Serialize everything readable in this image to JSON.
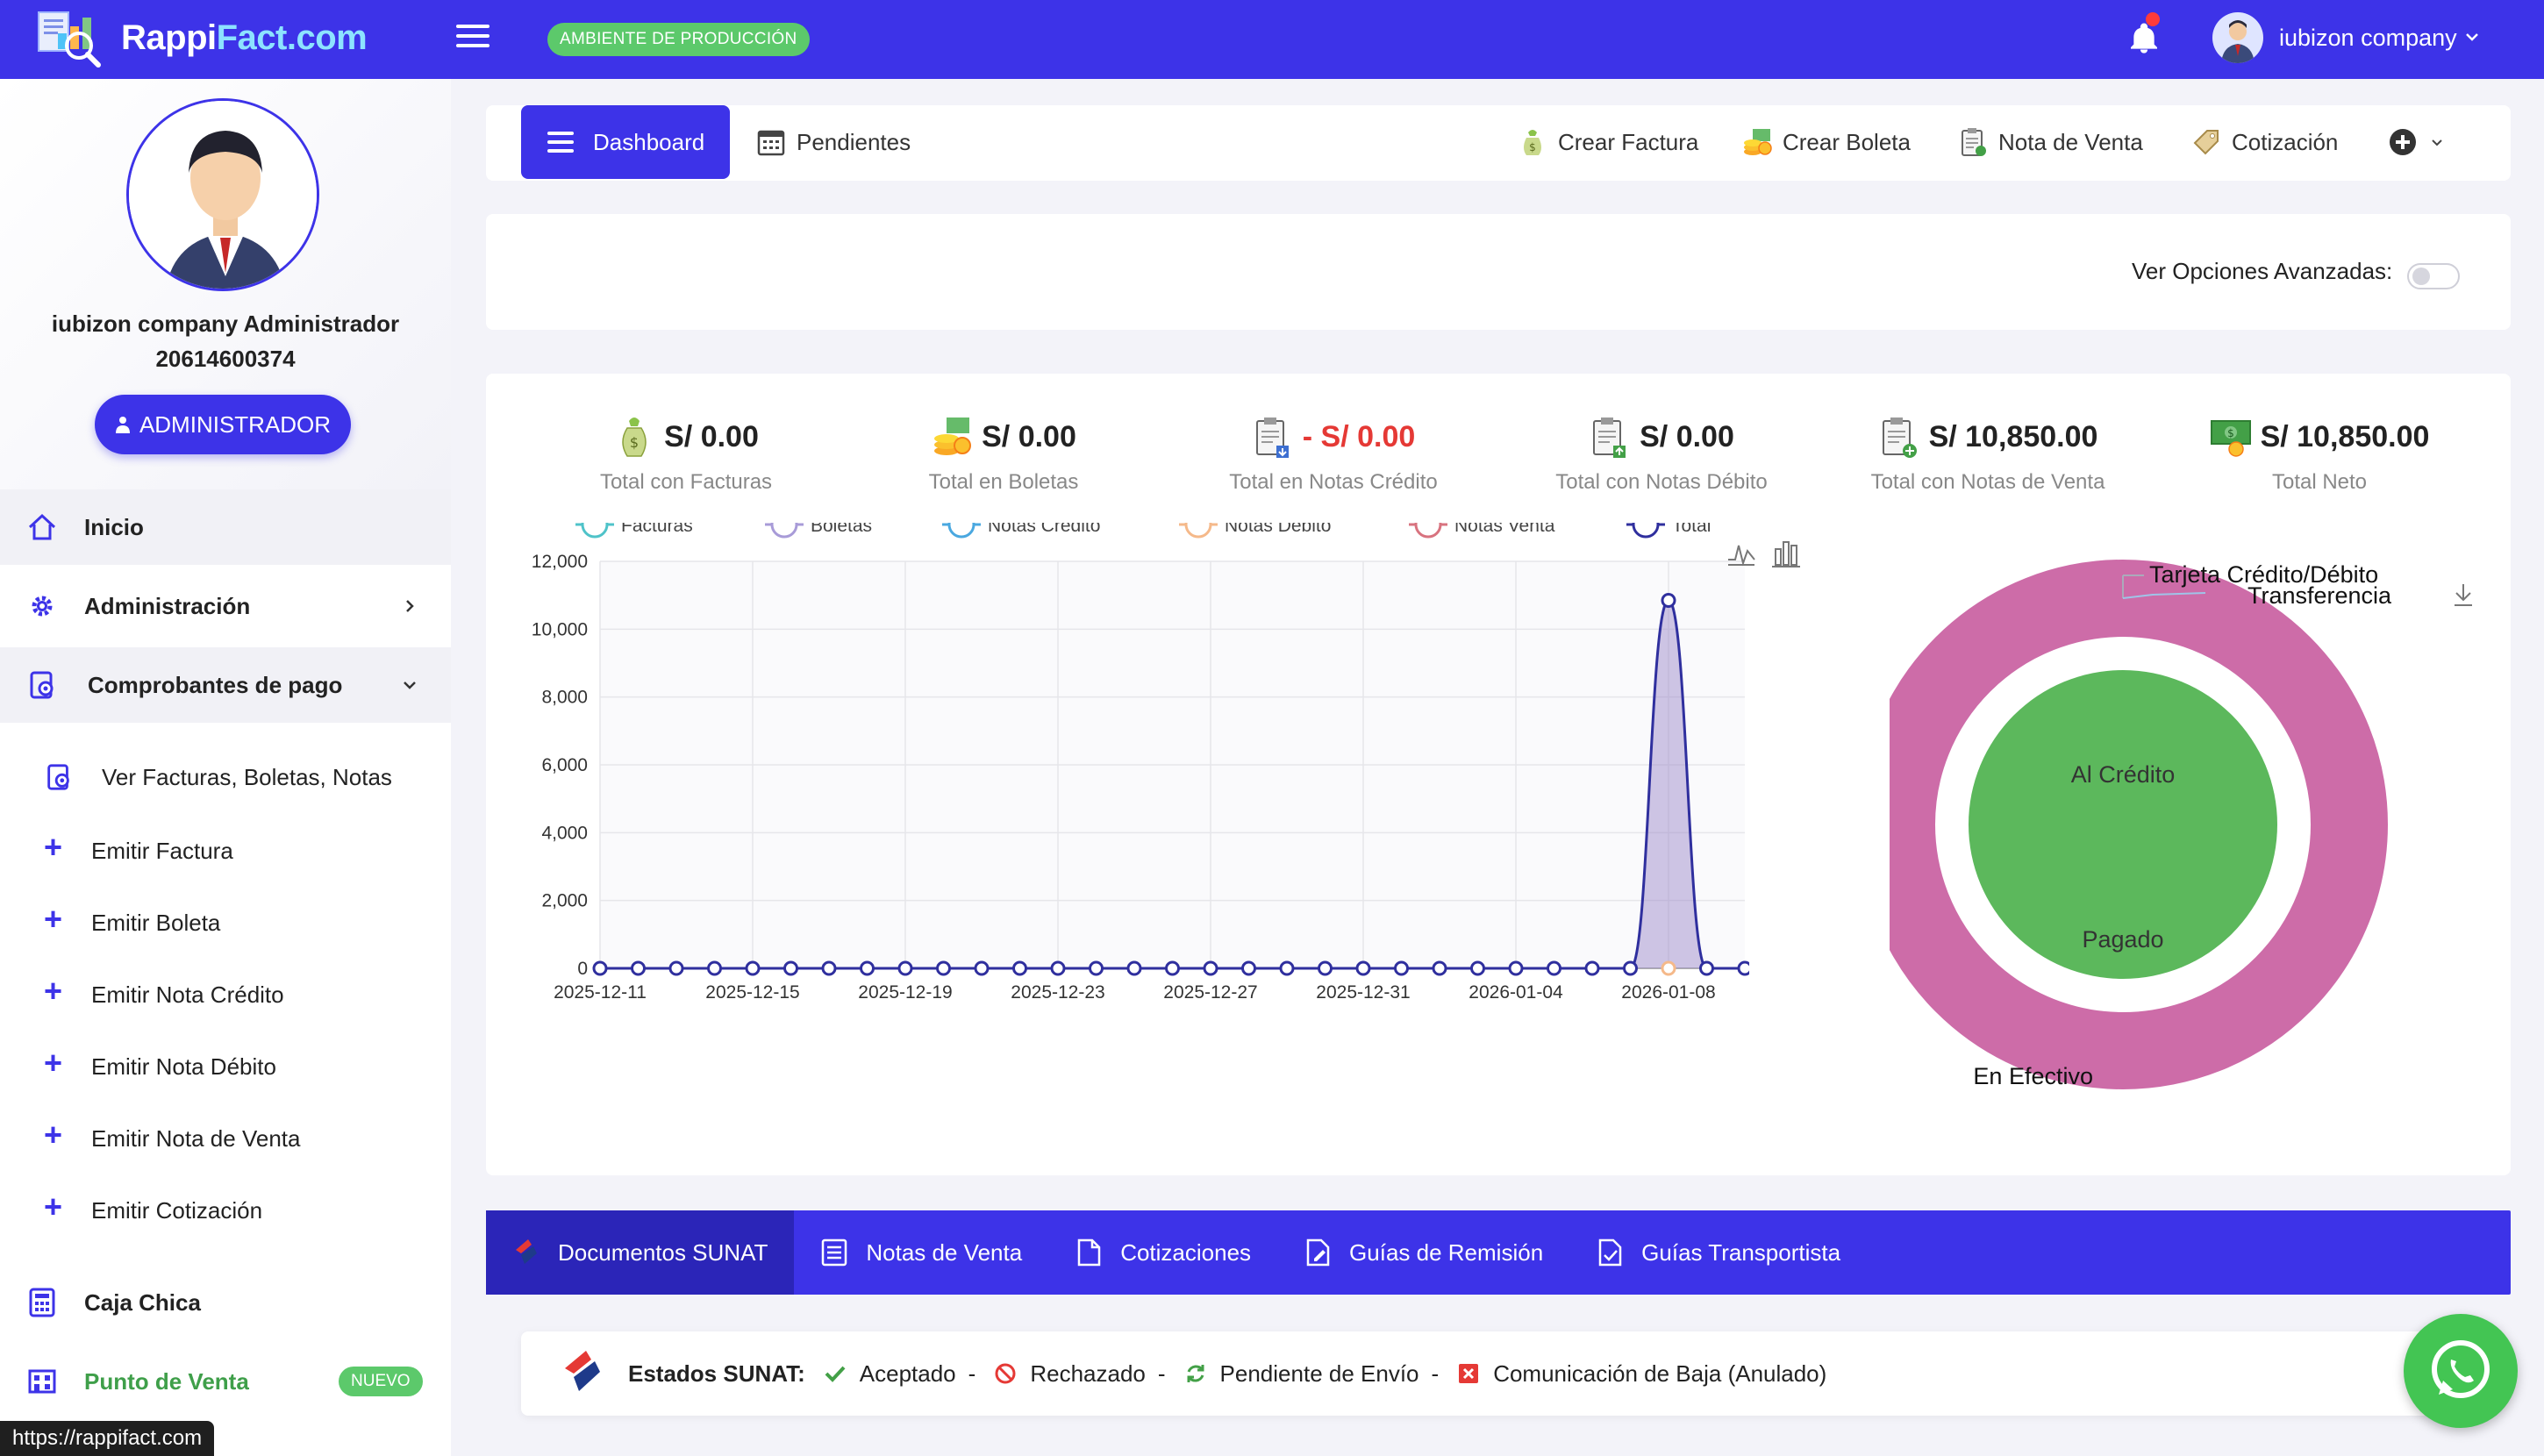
{
  "topbar": {
    "logo_text_a": "Rappi",
    "logo_text_b": "Fact.com",
    "env_badge": "AMBIENTE DE PRODUCCIÓN",
    "user_name": "iubizon company"
  },
  "sidebar": {
    "name": "iubizon company Administrador",
    "ruc": "20614600374",
    "role_button": "ADMINISTRADOR",
    "items": [
      {
        "label": "Inicio",
        "icon": "home-icon"
      },
      {
        "label": "Administración",
        "icon": "gear-icon"
      },
      {
        "label": "Comprobantes de pago",
        "icon": "receipt-icon"
      }
    ],
    "sub_items": [
      {
        "label": "Ver Facturas, Boletas, Notas"
      },
      {
        "label": "Emitir Factura"
      },
      {
        "label": "Emitir Boleta"
      },
      {
        "label": "Emitir Nota Crédito"
      },
      {
        "label": "Emitir Nota Débito"
      },
      {
        "label": "Emitir Nota de Venta"
      },
      {
        "label": "Emitir Cotización"
      }
    ],
    "caja_chica": "Caja Chica",
    "punto_venta": "Punto de Venta",
    "nuevo_badge": "NUEVO",
    "url_tooltip": "https://rappifact.com"
  },
  "toolbar": {
    "dashboard": "Dashboard",
    "pendientes": "Pendientes",
    "crear_factura": "Crear Factura",
    "crear_boleta": "Crear Boleta",
    "nota_venta": "Nota de Venta",
    "cotizacion": "Cotización"
  },
  "advanced": {
    "label": "Ver Opciones Avanzadas:"
  },
  "stats": [
    {
      "value": "S/ 0.00",
      "caption": "Total con Facturas"
    },
    {
      "value": "S/ 0.00",
      "caption": "Total en Boletas"
    },
    {
      "value_prefix": "- ",
      "value": "S/ 0.00",
      "caption": "Total en Notas Crédito"
    },
    {
      "value": "S/ 0.00",
      "caption": "Total con Notas Débito"
    },
    {
      "value": "S/ 10,850.00",
      "caption": "Total con Notas de Venta"
    },
    {
      "value": "S/ 10,850.00",
      "caption": "Total Neto"
    }
  ],
  "chart_data": [
    {
      "type": "line",
      "series": [
        {
          "name": "Facturas",
          "color": "#4fc3c9"
        },
        {
          "name": "Boletas",
          "color": "#a89bd8"
        },
        {
          "name": "Notas Crédito",
          "color": "#4aa8e0"
        },
        {
          "name": "Notas Débito",
          "color": "#f5b98a"
        },
        {
          "name": "Notas Venta",
          "color": "#d8737f"
        },
        {
          "name": "Total",
          "color": "#2f2f9e"
        }
      ],
      "x_tick_labels": [
        "2025-12-11",
        "2025-12-15",
        "2025-12-19",
        "2025-12-23",
        "2025-12-27",
        "2025-12-31",
        "2026-01-04",
        "2026-01-08"
      ],
      "y_ticks": [
        "0",
        "2,000",
        "4,000",
        "6,000",
        "8,000",
        "10,000",
        "12,000"
      ],
      "ylim": [
        0,
        12000
      ],
      "total_values": [
        0,
        0,
        0,
        0,
        0,
        0,
        0,
        0,
        0,
        0,
        0,
        0,
        0,
        0,
        0,
        0,
        0,
        0,
        0,
        0,
        0,
        0,
        0,
        0,
        0,
        0,
        0,
        0,
        10850,
        0,
        0
      ],
      "grid": true,
      "legend": "top"
    },
    {
      "type": "pie",
      "labels": [
        "Tarjeta Crédito/Débito",
        "Transferencia",
        "Al Crédito",
        "Pagado",
        "En Efectivo"
      ],
      "outer_ring": {
        "label": "En Efectivo",
        "color": "#cd6ca8"
      },
      "inner_circle": {
        "labels": [
          "Al Crédito",
          "Pagado"
        ],
        "color": "#5cb85c"
      }
    }
  ],
  "tabs": [
    {
      "label": "Documentos SUNAT"
    },
    {
      "label": "Notas de Venta"
    },
    {
      "label": "Cotizaciones"
    },
    {
      "label": "Guías de Remisión"
    },
    {
      "label": "Guías Transportista"
    }
  ],
  "sunat_legend": {
    "title": "Estados SUNAT:",
    "aceptado": "Aceptado",
    "rechazado": "Rechazado",
    "pendiente": "Pendiente de Envío",
    "baja": "Comunicación de Baja (Anulado)",
    "sep": "-"
  }
}
